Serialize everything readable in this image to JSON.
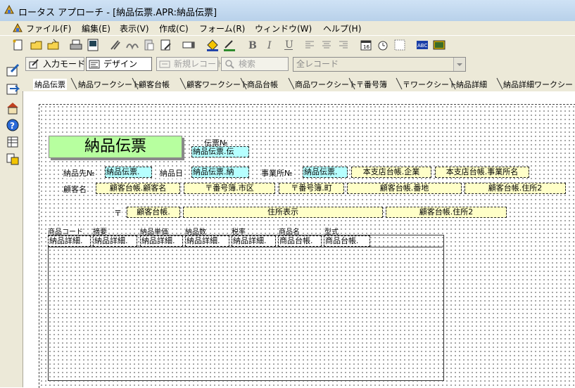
{
  "window": {
    "title": "ロータス アプローチ - [納品伝票.APR:納品伝票]"
  },
  "menu": [
    "ファイル(F)",
    "編集(E)",
    "表示(V)",
    "作成(C)",
    "フォーム(R)",
    "ウィンドウ(W)",
    "ヘルプ(H)"
  ],
  "toolbar2": {
    "input_mode": "入力モード",
    "design": "デザイン",
    "new_record": "新規レコード",
    "search": "検索",
    "record_combo": "全レコード"
  },
  "tabs": [
    "納品伝票",
    "納品ワークシート",
    "顧客台帳",
    "顧客ワークシート",
    "商品台帳",
    "商品ワークシート",
    "〒番号簿",
    "〒ワークシート",
    "納品詳細",
    "納品詳細ワークシート"
  ],
  "form": {
    "title": "納品伝票",
    "slip_no_label": "伝票№",
    "slip_no_field": "納品伝票.伝",
    "row1": {
      "delivery_to_label": "納品先№",
      "delivery_to_field": "納品伝票.",
      "date_label": "納品日",
      "date_field": "納品伝票.納",
      "office_label": "事業所№",
      "office_field": "納品伝票.",
      "company_field": "本支店台帳.企業",
      "office_name_field": "本支店台帳.事業所名"
    },
    "row2": {
      "customer_label": "顧客名",
      "customer_field": "顧客台帳.顧客名",
      "city_field": "〒番号簿.市区",
      "town_field": "〒番号簿.町",
      "address_field": "顧客台帳.番地",
      "address2_field": "顧客台帳.住所2"
    },
    "row3": {
      "zip_label": "〒",
      "zip_field": "顧客台帳.",
      "address_display": "住所表示",
      "address2_field": "顧客台帳.住所2"
    },
    "detail_headers": [
      "商品コード",
      "摘要",
      "納品単価",
      "納品数",
      "税率",
      "商品名",
      "型式"
    ],
    "detail_fields": [
      "納品詳細.",
      "納品詳細.",
      "納品詳細.",
      "納品詳細.",
      "納品詳細.",
      "商品台帳.",
      "商品台帳."
    ]
  },
  "colors": {
    "title_green": "#b7ff9f",
    "field_cyan": "#b6ffff",
    "field_yellow": "#ffffc8",
    "chrome": "#ece9d8"
  }
}
